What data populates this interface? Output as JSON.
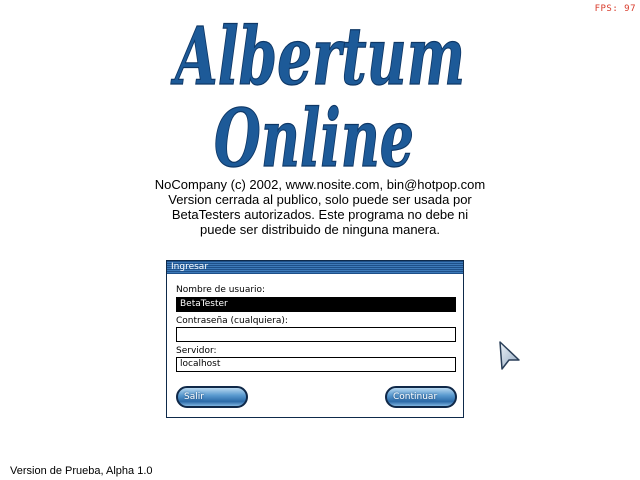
{
  "fps": "FPS: 97",
  "logo": {
    "line1": "Albertum",
    "line2": "Online",
    "color": "#1d5a98"
  },
  "intro": {
    "line1": "NoCompany (c) 2002, www.nosite.com, bin@hotpop.com",
    "line2": "Version cerrada al publico, solo puede ser usada por",
    "line3": "BetaTesters autorizados. Este programa no debe ni",
    "line4": "puede ser distribuido de ninguna manera."
  },
  "login": {
    "title": "Ingresar",
    "username_label": "Nombre de usuario:",
    "username_value": "BetaTester",
    "password_label": "Contraseña (cualquiera):",
    "password_value": "",
    "server_label": "Servidor:",
    "server_value": "localhost",
    "exit_label": "Salir",
    "continue_label": "Continuar"
  },
  "version": "Version de Prueba, Alpha 1.0",
  "icons": {
    "cursor": "arrow-cursor-icon"
  },
  "colors": {
    "fps": "#d83a2a",
    "panel_title": "#2d67a5",
    "button": "#3b7bbd"
  }
}
